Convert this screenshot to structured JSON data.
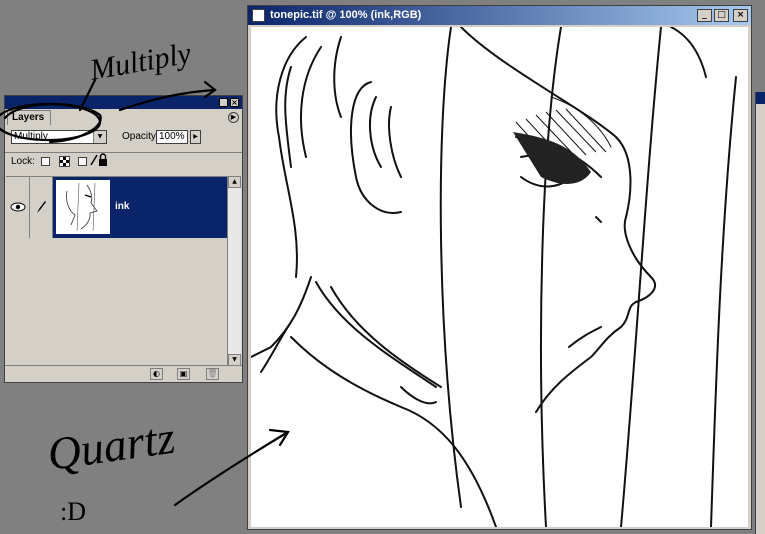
{
  "layers_panel": {
    "tab_label": "Layers",
    "blend_mode": "Multiply",
    "opacity_label": "Opacity:",
    "opacity_value": "100%",
    "lock_label": "Lock:",
    "layers": [
      {
        "name": "ink",
        "visible": true,
        "selected": true
      }
    ]
  },
  "document": {
    "title": "tonepic.tif @ 100% (ink,RGB)"
  },
  "annotations": {
    "multiply_note": "Multiply",
    "quartz_note": "Quartz",
    "smiley": ":D"
  },
  "colors": {
    "selection": "#0a246a",
    "panel_bg": "#d4d0c8",
    "desktop": "#808080"
  },
  "icons": [
    "eye-icon",
    "brush-icon",
    "lock-icon",
    "palette-menu-icon",
    "new-adjustment-icon",
    "new-layer-icon",
    "trash-icon"
  ]
}
